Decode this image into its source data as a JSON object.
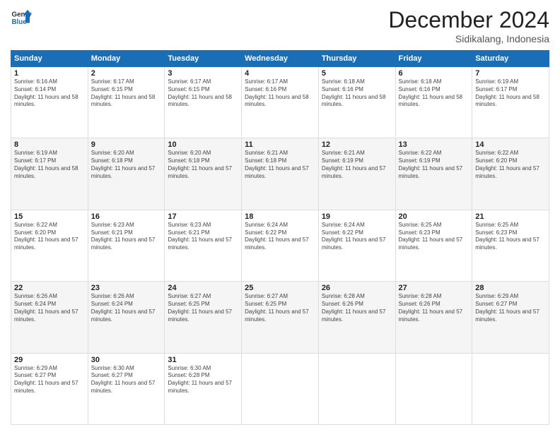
{
  "logo": {
    "line1": "General",
    "line2": "Blue"
  },
  "title": "December 2024",
  "location": "Sidikalang, Indonesia",
  "days_of_week": [
    "Sunday",
    "Monday",
    "Tuesday",
    "Wednesday",
    "Thursday",
    "Friday",
    "Saturday"
  ],
  "weeks": [
    [
      {
        "day": "1",
        "sunrise": "6:16 AM",
        "sunset": "6:14 PM",
        "daylight": "11 hours and 58 minutes."
      },
      {
        "day": "2",
        "sunrise": "6:17 AM",
        "sunset": "6:15 PM",
        "daylight": "11 hours and 58 minutes."
      },
      {
        "day": "3",
        "sunrise": "6:17 AM",
        "sunset": "6:15 PM",
        "daylight": "11 hours and 58 minutes."
      },
      {
        "day": "4",
        "sunrise": "6:17 AM",
        "sunset": "6:16 PM",
        "daylight": "11 hours and 58 minutes."
      },
      {
        "day": "5",
        "sunrise": "6:18 AM",
        "sunset": "6:16 PM",
        "daylight": "11 hours and 58 minutes."
      },
      {
        "day": "6",
        "sunrise": "6:18 AM",
        "sunset": "6:16 PM",
        "daylight": "11 hours and 58 minutes."
      },
      {
        "day": "7",
        "sunrise": "6:19 AM",
        "sunset": "6:17 PM",
        "daylight": "11 hours and 58 minutes."
      }
    ],
    [
      {
        "day": "8",
        "sunrise": "6:19 AM",
        "sunset": "6:17 PM",
        "daylight": "11 hours and 58 minutes."
      },
      {
        "day": "9",
        "sunrise": "6:20 AM",
        "sunset": "6:18 PM",
        "daylight": "11 hours and 57 minutes."
      },
      {
        "day": "10",
        "sunrise": "6:20 AM",
        "sunset": "6:18 PM",
        "daylight": "11 hours and 57 minutes."
      },
      {
        "day": "11",
        "sunrise": "6:21 AM",
        "sunset": "6:18 PM",
        "daylight": "11 hours and 57 minutes."
      },
      {
        "day": "12",
        "sunrise": "6:21 AM",
        "sunset": "6:19 PM",
        "daylight": "11 hours and 57 minutes."
      },
      {
        "day": "13",
        "sunrise": "6:22 AM",
        "sunset": "6:19 PM",
        "daylight": "11 hours and 57 minutes."
      },
      {
        "day": "14",
        "sunrise": "6:22 AM",
        "sunset": "6:20 PM",
        "daylight": "11 hours and 57 minutes."
      }
    ],
    [
      {
        "day": "15",
        "sunrise": "6:22 AM",
        "sunset": "6:20 PM",
        "daylight": "11 hours and 57 minutes."
      },
      {
        "day": "16",
        "sunrise": "6:23 AM",
        "sunset": "6:21 PM",
        "daylight": "11 hours and 57 minutes."
      },
      {
        "day": "17",
        "sunrise": "6:23 AM",
        "sunset": "6:21 PM",
        "daylight": "11 hours and 57 minutes."
      },
      {
        "day": "18",
        "sunrise": "6:24 AM",
        "sunset": "6:22 PM",
        "daylight": "11 hours and 57 minutes."
      },
      {
        "day": "19",
        "sunrise": "6:24 AM",
        "sunset": "6:22 PM",
        "daylight": "11 hours and 57 minutes."
      },
      {
        "day": "20",
        "sunrise": "6:25 AM",
        "sunset": "6:23 PM",
        "daylight": "11 hours and 57 minutes."
      },
      {
        "day": "21",
        "sunrise": "6:25 AM",
        "sunset": "6:23 PM",
        "daylight": "11 hours and 57 minutes."
      }
    ],
    [
      {
        "day": "22",
        "sunrise": "6:26 AM",
        "sunset": "6:24 PM",
        "daylight": "11 hours and 57 minutes."
      },
      {
        "day": "23",
        "sunrise": "6:26 AM",
        "sunset": "6:24 PM",
        "daylight": "11 hours and 57 minutes."
      },
      {
        "day": "24",
        "sunrise": "6:27 AM",
        "sunset": "6:25 PM",
        "daylight": "11 hours and 57 minutes."
      },
      {
        "day": "25",
        "sunrise": "6:27 AM",
        "sunset": "6:25 PM",
        "daylight": "11 hours and 57 minutes."
      },
      {
        "day": "26",
        "sunrise": "6:28 AM",
        "sunset": "6:26 PM",
        "daylight": "11 hours and 57 minutes."
      },
      {
        "day": "27",
        "sunrise": "6:28 AM",
        "sunset": "6:26 PM",
        "daylight": "11 hours and 57 minutes."
      },
      {
        "day": "28",
        "sunrise": "6:29 AM",
        "sunset": "6:27 PM",
        "daylight": "11 hours and 57 minutes."
      }
    ],
    [
      {
        "day": "29",
        "sunrise": "6:29 AM",
        "sunset": "6:27 PM",
        "daylight": "11 hours and 57 minutes."
      },
      {
        "day": "30",
        "sunrise": "6:30 AM",
        "sunset": "6:27 PM",
        "daylight": "11 hours and 57 minutes."
      },
      {
        "day": "31",
        "sunrise": "6:30 AM",
        "sunset": "6:28 PM",
        "daylight": "11 hours and 57 minutes."
      },
      null,
      null,
      null,
      null
    ]
  ]
}
